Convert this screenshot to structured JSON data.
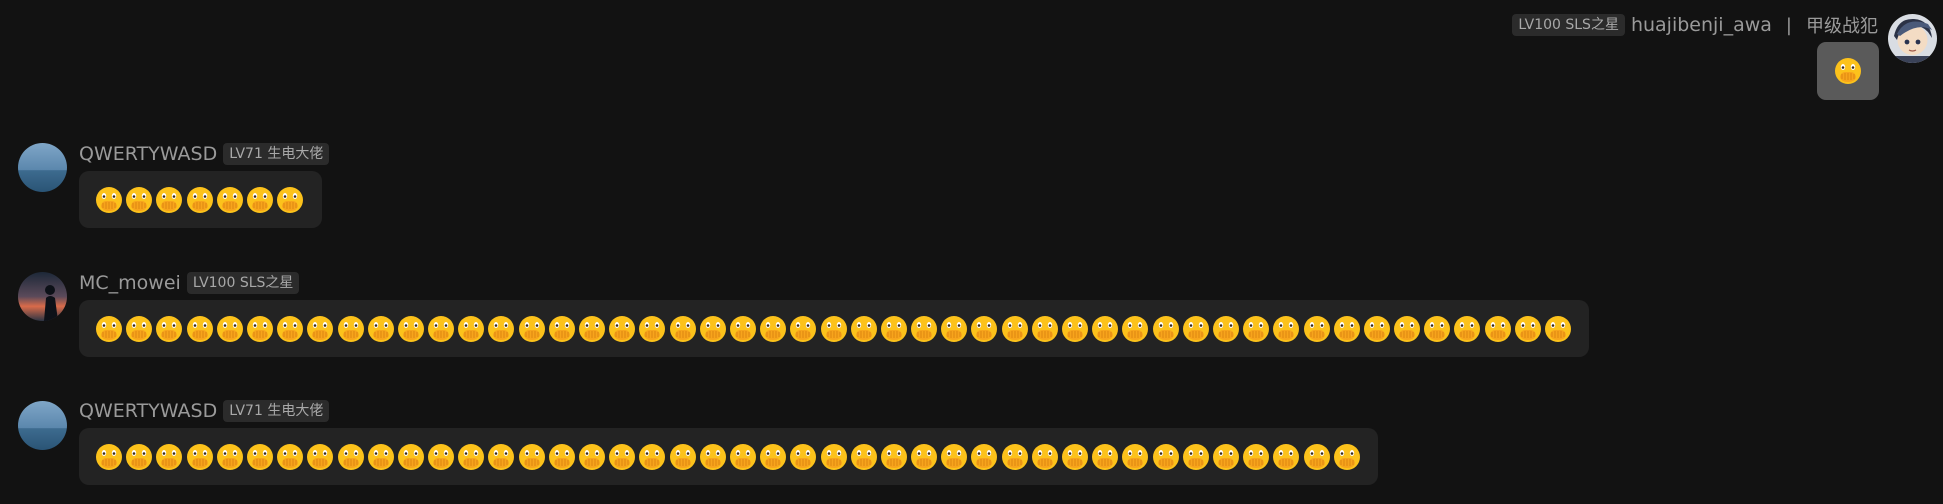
{
  "messages": [
    {
      "side": "right",
      "username": "huajibenji_awa",
      "level_badge": "LV100 SLS之星",
      "separator": "|",
      "title": "甲级战犯",
      "avatar": "anime-character-avatar",
      "emoji": "face-with-open-eyes-and-hand-over-mouth",
      "emoji_count": 1
    },
    {
      "side": "left",
      "username": "QWERTYWASD",
      "level_badge": "LV71 生电大佬",
      "avatar": "sea-landscape-avatar",
      "emoji": "face-with-open-eyes-and-hand-over-mouth",
      "emoji_count": 7
    },
    {
      "side": "left",
      "username": "MC_mowei",
      "level_badge": "LV100 SLS之星",
      "avatar": "sunset-silhouette-avatar",
      "emoji": "face-with-open-eyes-and-hand-over-mouth",
      "emoji_count": 49
    },
    {
      "side": "left",
      "username": "QWERTYWASD",
      "level_badge": "LV71 生电大佬",
      "avatar": "sea-landscape-avatar",
      "emoji": "face-with-open-eyes-and-hand-over-mouth",
      "emoji_count": 42
    }
  ],
  "colors": {
    "background": "#121212",
    "bubble": "#232323",
    "own_bubble": "#5a5a5a",
    "badge_bg": "#2b2b2b",
    "text_muted": "#9a9a9a"
  }
}
